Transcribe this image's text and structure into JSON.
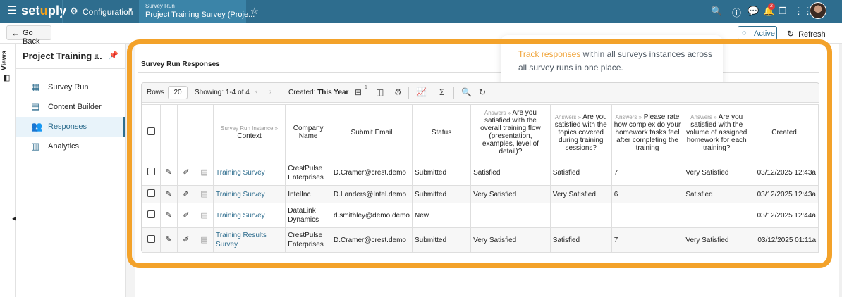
{
  "topbar": {
    "menu_icon": "hamburger-icon",
    "logo": "setuply",
    "config_label": "Configuration",
    "tab_line1": "Survey Run",
    "tab_line2": "Project Training Survey (Proje...",
    "notifications_count": "2"
  },
  "subbar": {
    "go_back": "Go Back",
    "status": "Active",
    "refresh": "Refresh"
  },
  "rail": {
    "views_label": "Views"
  },
  "sidebar": {
    "title": "Project Training ...",
    "items": [
      {
        "label": "Survey Run",
        "icon": "grid-icon"
      },
      {
        "label": "Content Builder",
        "icon": "document-icon"
      },
      {
        "label": "Responses",
        "icon": "users-icon"
      },
      {
        "label": "Analytics",
        "icon": "chart-icon"
      }
    ]
  },
  "main": {
    "title": "Survey Run Responses",
    "callout_highlight": "Track responses",
    "callout_rest": " within all surveys instances across all survey runs in one place."
  },
  "toolbar": {
    "rows_label": "Rows",
    "rows_value": "20",
    "showing": "Showing: 1-4 of 4",
    "created_label": "Created:",
    "created_value": "This Year",
    "filter_count": "1"
  },
  "table": {
    "headers": {
      "context_prefix": "Survey Run Instance »",
      "context": "Context",
      "company": "Company Name",
      "email": "Submit Email",
      "status": "Status",
      "q1_prefix": "Answers »",
      "q1": "Are you satisfied with the overall training flow (presentation, examples, level of detail)?",
      "q2_prefix": "Answers »",
      "q2": "Are you satisfied with the topics covered during training sessions?",
      "q3_prefix": "Answers »",
      "q3": "Please rate how complex do your homework tasks feel after completing the training",
      "q4_prefix": "Answers »",
      "q4": "Are you satisfied with the volume of assigned homework for each training?",
      "created": "Created"
    },
    "rows": [
      {
        "context": "Training Survey",
        "company": "CrestPulse Enterprises",
        "email": "D.Cramer@crest.demo",
        "status": "Submitted",
        "q1": "Satisfied",
        "q2": "Satisfied",
        "q3": "7",
        "q4": "Very Satisfied",
        "created": "03/12/2025 12:43a"
      },
      {
        "context": "Training Survey",
        "company": "IntelInc",
        "email": "D.Landers@Intel.demo",
        "status": "Submitted",
        "q1": "Very Satisfied",
        "q2": "Very Satisfied",
        "q3": "6",
        "q4": "Satisfied",
        "created": "03/12/2025 12:43a"
      },
      {
        "context": "Training Survey",
        "company": "DataLink Dynamics",
        "email": "d.smithley@demo.demo",
        "status": "New",
        "q1": "",
        "q2": "",
        "q3": "",
        "q4": "",
        "created": "03/12/2025 12:44a"
      },
      {
        "context": "Training Results Survey",
        "company": "CrestPulse Enterprises",
        "email": "D.Cramer@crest.demo",
        "status": "Submitted",
        "q1": "Very Satisfied",
        "q2": "Satisfied",
        "q3": "7",
        "q4": "Very Satisfied",
        "created": "03/12/2025 01:11a"
      }
    ]
  },
  "colors": {
    "brand": "#2e6d8e",
    "accent": "#f3a22a",
    "logo_accent": "#f7a21b"
  }
}
